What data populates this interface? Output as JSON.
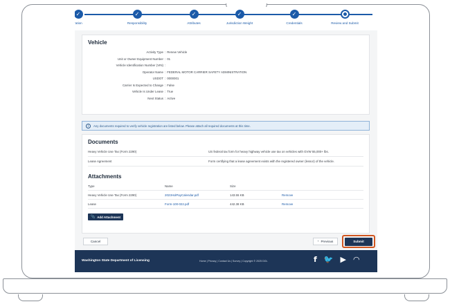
{
  "stepper": {
    "steps": [
      {
        "label": "ration",
        "icon": "check-icon"
      },
      {
        "label": "Responsibility",
        "icon": "check-icon"
      },
      {
        "label": "Attributes",
        "icon": "check-icon"
      },
      {
        "label": "Jurisdiction Weight",
        "icon": "check-icon"
      },
      {
        "label": "Credentials",
        "icon": "check-icon"
      },
      {
        "label": "Review and Submit",
        "icon": "current-step-icon"
      }
    ]
  },
  "vehicle": {
    "title": "Vehicle",
    "fields": [
      {
        "key": "Activity Type",
        "value": "Renew Vehicle"
      },
      {
        "key": "Unit or Owner Equipment Number",
        "value": "01"
      },
      {
        "key": "Vehicle Identification Number (VIN)",
        "value": ""
      },
      {
        "key": "Operator Name",
        "value": "FEDERAL MOTOR CARRIER SAFETY ADMINISTRATION"
      },
      {
        "key": "USDOT",
        "value": "0000001"
      },
      {
        "key": "Carrier Is Expected to Change",
        "value": "False"
      },
      {
        "key": "Vehicle Is Under Lease",
        "value": "True"
      },
      {
        "key": "Next Status",
        "value": "Active"
      }
    ]
  },
  "info_message": "Any documents required to verify vehicle registration are listed below. Please attach all required documents at this time.",
  "documents": {
    "title": "Documents",
    "rows": [
      {
        "name": "Heavy Vehicle Use Tax (Form 2290)",
        "description": "US federal tax form for heavy highway vehicle use tax on vehicles with GVW 55,000+ lbs."
      },
      {
        "name": "Lease Agreement",
        "description": "Form certifying that a lease agreement exists with the registered owner (lessor) of the vehicle."
      }
    ]
  },
  "attachments": {
    "title": "Attachments",
    "headers": {
      "type": "Type",
      "name": "Name",
      "size": "Size"
    },
    "rows": [
      {
        "type": "Heavy Vehicle Use Tax (Form 2290)",
        "name": "2023HolPayCalendar.pdf",
        "size": "143.55 KB",
        "action": "Remove"
      },
      {
        "type": "Lease",
        "name": "Form-100-022.pdf",
        "size": "442.38 KB",
        "action": "Remove"
      }
    ],
    "add_label": "Add Attachment"
  },
  "actions": {
    "cancel": "Cancel",
    "previous": "Previous",
    "submit": "Submit",
    "highlight_color": "#d0551f"
  },
  "footer": {
    "org": "Washington State Department of Licensing",
    "links": "Home | Privacy | Contact Us | Survey | Copyright © 2025 DOL",
    "socials": [
      "facebook-icon",
      "twitter-icon",
      "youtube-icon",
      "rss-icon"
    ]
  },
  "colors": {
    "brand": "#1d3557",
    "accent": "#1b5aa8"
  }
}
